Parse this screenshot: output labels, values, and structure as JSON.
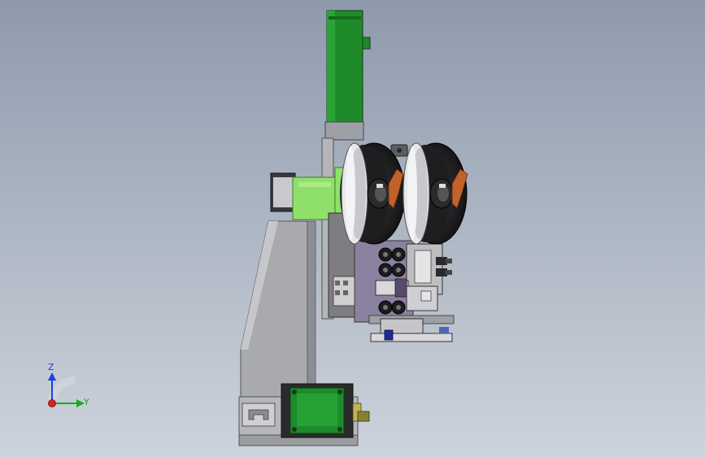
{
  "triad": {
    "z_label": "Z",
    "y_label": "Y",
    "z_color": "#1f3fd8",
    "y_color": "#1ea81e",
    "x_color": "#e02020"
  },
  "colors": {
    "background_top": "#8e9aac",
    "background_bottom": "#cdd3dc",
    "motor_green": "#1f8a2a",
    "bracket_green": "#8ee06a",
    "frame_grey": "#a9aaae",
    "plate_purple": "#8a82a0",
    "dark_metal": "#2b2b2e",
    "reel_light": "#e8e8ea",
    "orange_lever": "#c0622a"
  }
}
